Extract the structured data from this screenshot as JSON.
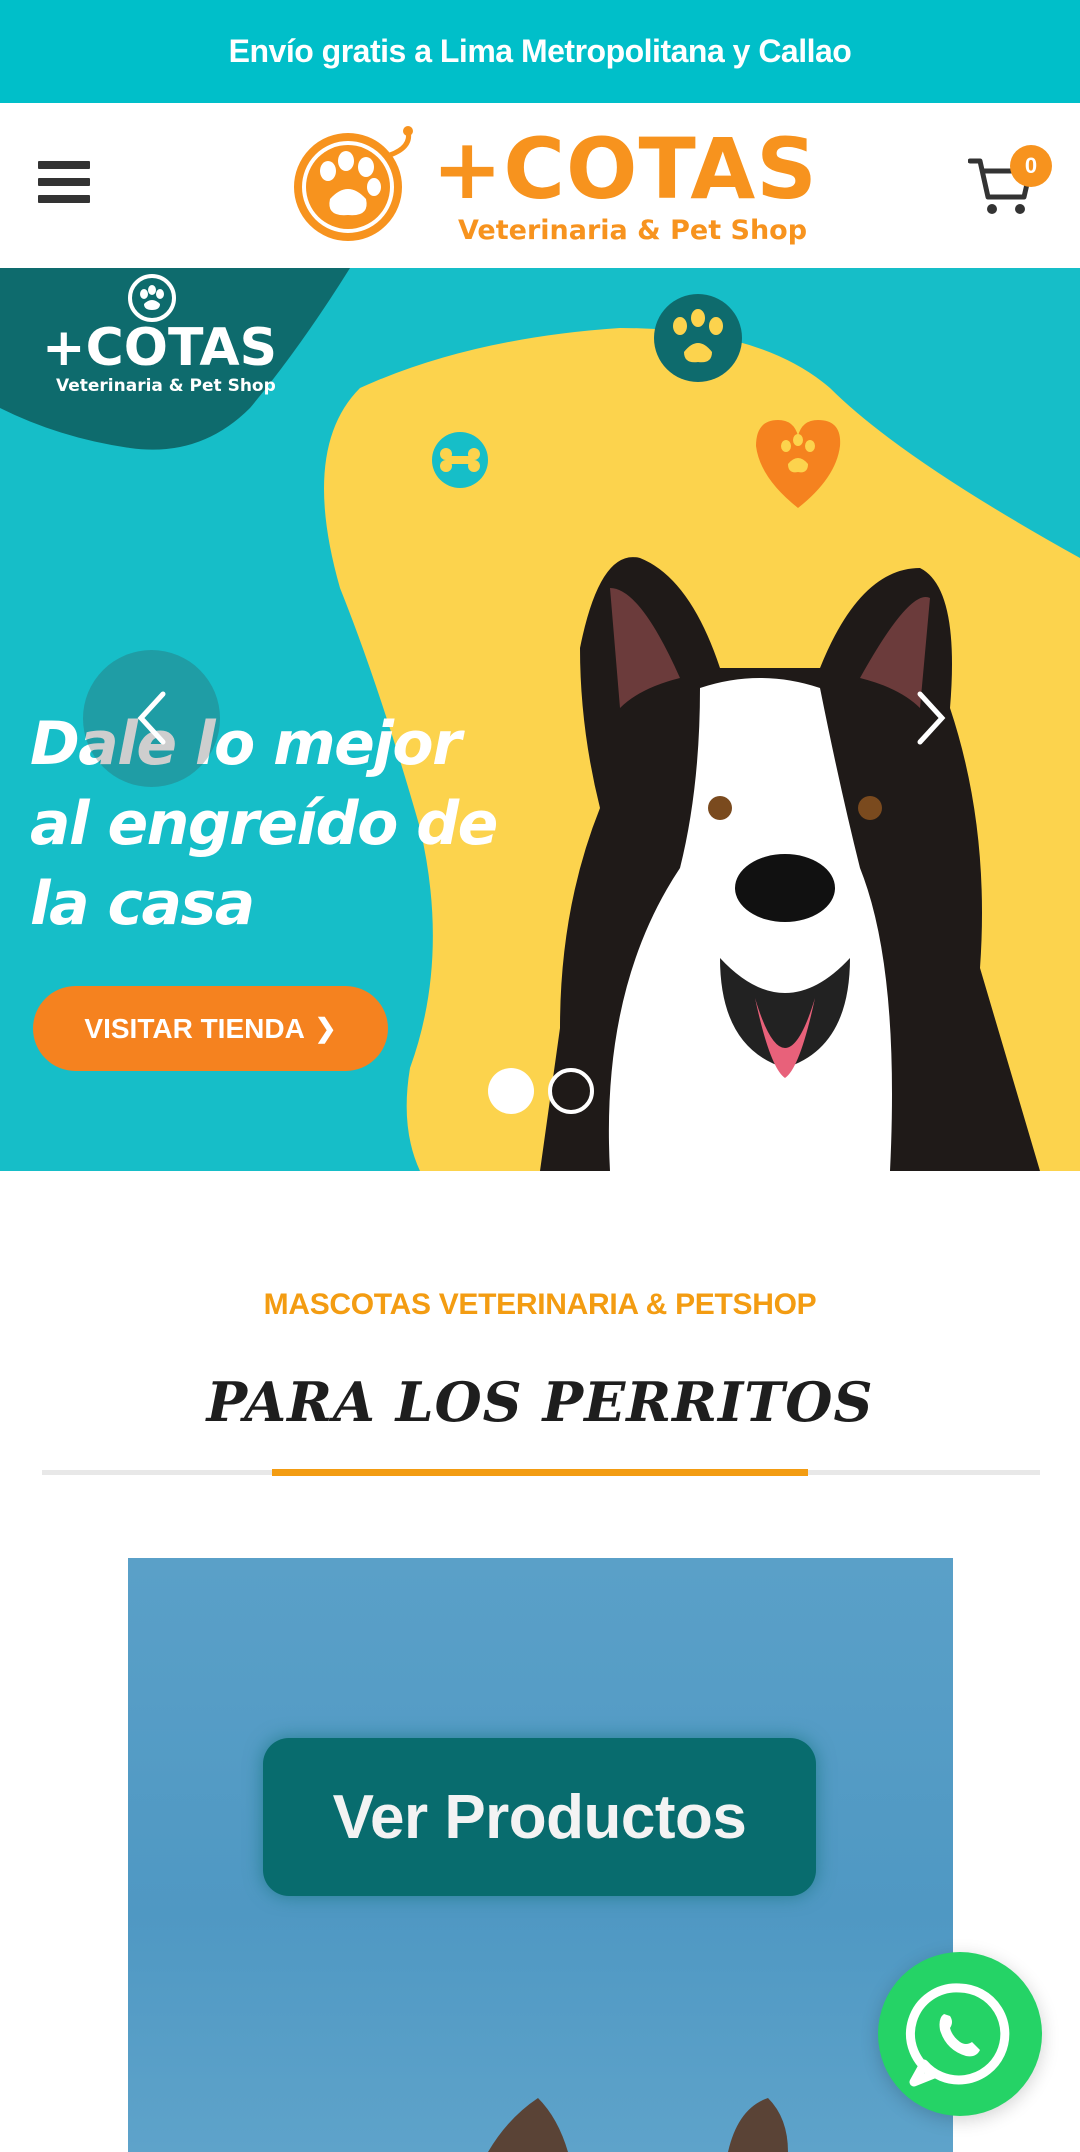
{
  "announcement": {
    "text": "Envío gratis a Lima Metropolitana y Callao"
  },
  "header": {
    "logo_title": "+COTAS",
    "logo_subtitle": "Veterinaria & Pet Shop",
    "cart_count": "0"
  },
  "hero": {
    "logo_title": "+COTAS",
    "logo_subtitle": "Veterinaria & Pet Shop",
    "headline": [
      "Dale lo mejor",
      "al engreído de",
      "la casa"
    ],
    "cta_label": "VISITAR TIENDA",
    "slides_total": 2,
    "active_slide": 1
  },
  "section": {
    "eyebrow": "MASCOTAS VETERINARIA & PETSHOP",
    "title": "PARA LOS PERRITOS"
  },
  "promo": {
    "button_label": "Ver Productos"
  },
  "colors": {
    "teal": "#00bfc9",
    "orange": "#f7931e",
    "yellow": "#fcd34d",
    "dark_teal": "#086c6e",
    "whatsapp": "#25d366"
  },
  "icons": [
    "menu-icon",
    "cart-icon",
    "chevron-left-icon",
    "chevron-right-icon",
    "chevron-right-small-icon",
    "whatsapp-icon",
    "paw-icon",
    "bone-icon",
    "heart-paw-icon"
  ]
}
